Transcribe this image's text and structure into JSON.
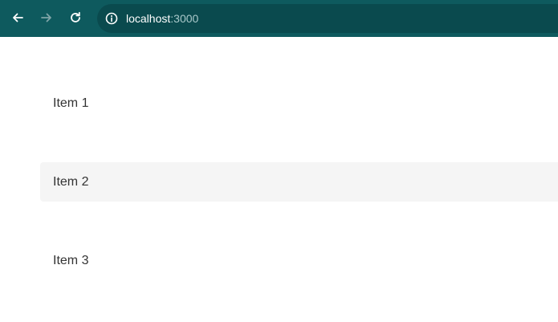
{
  "browser": {
    "url_host": "localhost",
    "url_port": ":3000",
    "colors": {
      "toolbar": "#0e5a5e",
      "omnibox": "#0a4a4e"
    }
  },
  "icons": {
    "back": "arrow-left-icon",
    "forward": "arrow-right-icon",
    "reload": "reload-icon",
    "site_info": "info-icon"
  },
  "list": {
    "items": [
      {
        "label": "Item 1",
        "highlighted": false
      },
      {
        "label": "Item 2",
        "highlighted": true
      },
      {
        "label": "Item 3",
        "highlighted": false
      }
    ],
    "highlight_color": "#f5f5f5"
  }
}
